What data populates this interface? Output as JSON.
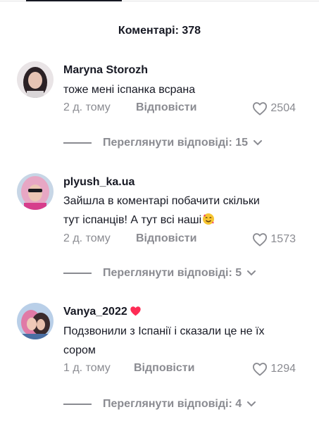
{
  "header": {
    "title": "Коментарі: 378"
  },
  "comments": [
    {
      "username": "Maryna Storozh",
      "lines": [
        "тоже мені іспанка всрана"
      ],
      "time": "2 д. тому",
      "reply_label": "Відповісти",
      "likes": "2504",
      "view_replies": "Переглянути відповіді: 15",
      "avatar_icon": "avatar-photo"
    },
    {
      "username": "plyush_ka.ua",
      "lines": [
        "Зайшла в коментарі побачити скільки",
        "тут іспанців! А тут всі наші"
      ],
      "trailing_emoji": "smiling-face-with-hearts-emoji",
      "time": "2 д. тому",
      "reply_label": "Відповісти",
      "likes": "1573",
      "view_replies": "Переглянути відповіді: 5",
      "avatar_icon": "avatar-photo"
    },
    {
      "username": "Vanya_2022",
      "username_badge": "heart-emoji",
      "lines": [
        "Подзвонили з Іспанії і сказали це не їх",
        "сором"
      ],
      "time": "1 д. тому",
      "reply_label": "Відповісти",
      "likes": "1294",
      "view_replies": "Переглянути відповіді: 4",
      "avatar_icon": "avatar-photo"
    }
  ],
  "colors": {
    "primary_text": "#161823",
    "secondary_text": "#8a8b91",
    "heart_badge": "#fe2c55"
  }
}
